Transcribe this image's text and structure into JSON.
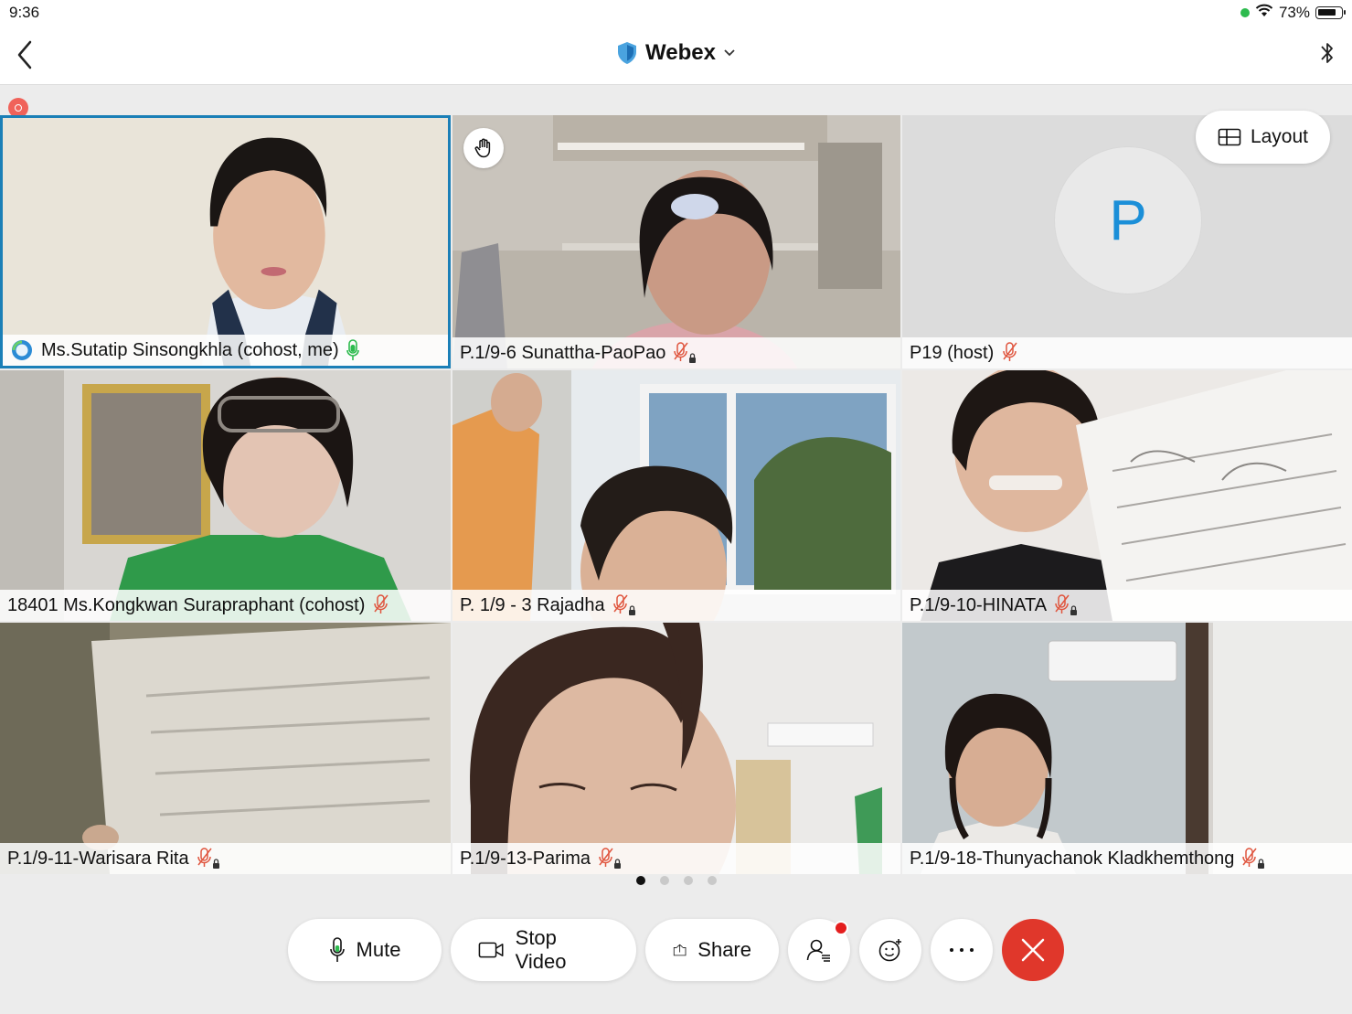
{
  "status_bar": {
    "time": "9:36",
    "battery": "73%"
  },
  "nav": {
    "title": "Webex"
  },
  "layout_button": {
    "label": "Layout"
  },
  "tiles": [
    {
      "name": "Ms.Sutatip Sinsongkhla (cohost, me)"
    },
    {
      "name": "P.1/9-6 Sunattha-PaoPao"
    },
    {
      "name": "P19 (host)",
      "avatar_letter": "P"
    },
    {
      "name": "18401 Ms.Kongkwan Surapraphant (cohost)"
    },
    {
      "name": "P. 1/9 - 3 Rajadha"
    },
    {
      "name": "P.1/9-10-HINATA"
    },
    {
      "name": "P.1/9-11-Warisara Rita"
    },
    {
      "name": "P.1/9-13-Parima"
    },
    {
      "name": "P.1/9-18-Thunyachanok Kladkhemthong"
    }
  ],
  "pager": {
    "pages": 4,
    "current": 1
  },
  "controls": {
    "mute": "Mute",
    "stop_video": "Stop Video",
    "share": "Share"
  },
  "colors": {
    "accent": "#1b7fb7",
    "end_call": "#e0372b",
    "muted_icon": "#e0563f",
    "active_mic": "#2dbb4e",
    "avatar_letter": "#1b8fd8"
  }
}
